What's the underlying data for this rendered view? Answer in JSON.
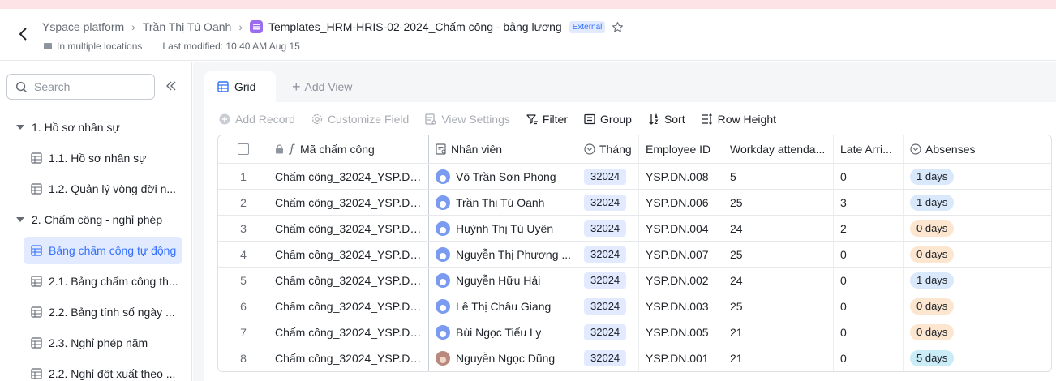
{
  "header": {
    "breadcrumbs": [
      "Yspace platform",
      "Trần Thị Tú Oanh"
    ],
    "doc_title": "Templates_HRM-HRIS-02-2024_Chấm công - bảng lương",
    "badge": "External",
    "location": "In multiple locations",
    "last_modified": "Last modified: 10:40 AM Aug 15"
  },
  "sidebar": {
    "search_placeholder": "Search",
    "groups": [
      {
        "label": "1. Hồ sơ nhân sự"
      },
      {
        "label": "2. Chấm công - nghỉ phép"
      }
    ],
    "items": [
      {
        "label": "1.1. Hồ sơ nhân sự"
      },
      {
        "label": "1.2. Quản lý vòng đời n..."
      },
      {
        "label": "Bảng chấm công tự động"
      },
      {
        "label": "2.1. Bảng chấm công th..."
      },
      {
        "label": "2.2. Bảng tính số ngày ..."
      },
      {
        "label": "2.3. Nghỉ phép năm"
      },
      {
        "label": "2.2. Nghỉ đột xuất theo ..."
      }
    ]
  },
  "tabs": {
    "grid": "Grid",
    "add_view": "Add View"
  },
  "toolbar": {
    "add_record": "Add Record",
    "customize_field": "Customize Field",
    "view_settings": "View Settings",
    "filter": "Filter",
    "group": "Group",
    "sort": "Sort",
    "row_height": "Row Height"
  },
  "table": {
    "columns": [
      "Mã chấm công",
      "Nhân viên",
      "Tháng",
      "Employee ID",
      "Workday attenda...",
      "Late Arri...",
      "Absenses"
    ],
    "rows": [
      {
        "n": "1",
        "code": "Chấm công_32024_YSP.DN....",
        "employee": "Võ Trần Sơn Phong",
        "month": "32024",
        "emp_id": "YSP.DN.008",
        "workday": "5",
        "late": "0",
        "absences": "1 days"
      },
      {
        "n": "2",
        "code": "Chấm công_32024_YSP.DN....",
        "employee": "Trần Thị Tú Oanh",
        "month": "32024",
        "emp_id": "YSP.DN.006",
        "workday": "25",
        "late": "3",
        "absences": "1 days"
      },
      {
        "n": "3",
        "code": "Chấm công_32024_YSP.DN....",
        "employee": "Huỳnh Thị Tú Uyên",
        "month": "32024",
        "emp_id": "YSP.DN.004",
        "workday": "24",
        "late": "2",
        "absences": "0 days"
      },
      {
        "n": "4",
        "code": "Chấm công_32024_YSP.DN....",
        "employee": "Nguyễn Thị Phương ...",
        "month": "32024",
        "emp_id": "YSP.DN.007",
        "workday": "25",
        "late": "0",
        "absences": "0 days"
      },
      {
        "n": "5",
        "code": "Chấm công_32024_YSP.DN....",
        "employee": "Nguyễn Hữu Hải",
        "month": "32024",
        "emp_id": "YSP.DN.002",
        "workday": "24",
        "late": "0",
        "absences": "1 days"
      },
      {
        "n": "6",
        "code": "Chấm công_32024_YSP.DN....",
        "employee": "Lê Thị Châu Giang",
        "month": "32024",
        "emp_id": "YSP.DN.003",
        "workday": "25",
        "late": "0",
        "absences": "0 days"
      },
      {
        "n": "7",
        "code": "Chấm công_32024_YSP.DN....",
        "employee": "Bùi Ngọc Tiểu Ly",
        "month": "32024",
        "emp_id": "YSP.DN.005",
        "workday": "21",
        "late": "0",
        "absences": "0 days"
      },
      {
        "n": "8",
        "code": "Chấm công_32024_YSP.DN....",
        "employee": "Nguyễn Ngọc Dũng",
        "month": "32024",
        "emp_id": "YSP.DN.001",
        "workday": "21",
        "late": "0",
        "absences": "5 days"
      }
    ]
  },
  "colors": {
    "accent": "#3370ff",
    "top_strip": "#fde3e6",
    "tag_blue": "#d9e8fb",
    "tag_orange": "#fde6cf",
    "tag_cyan": "#c9ecf7"
  }
}
